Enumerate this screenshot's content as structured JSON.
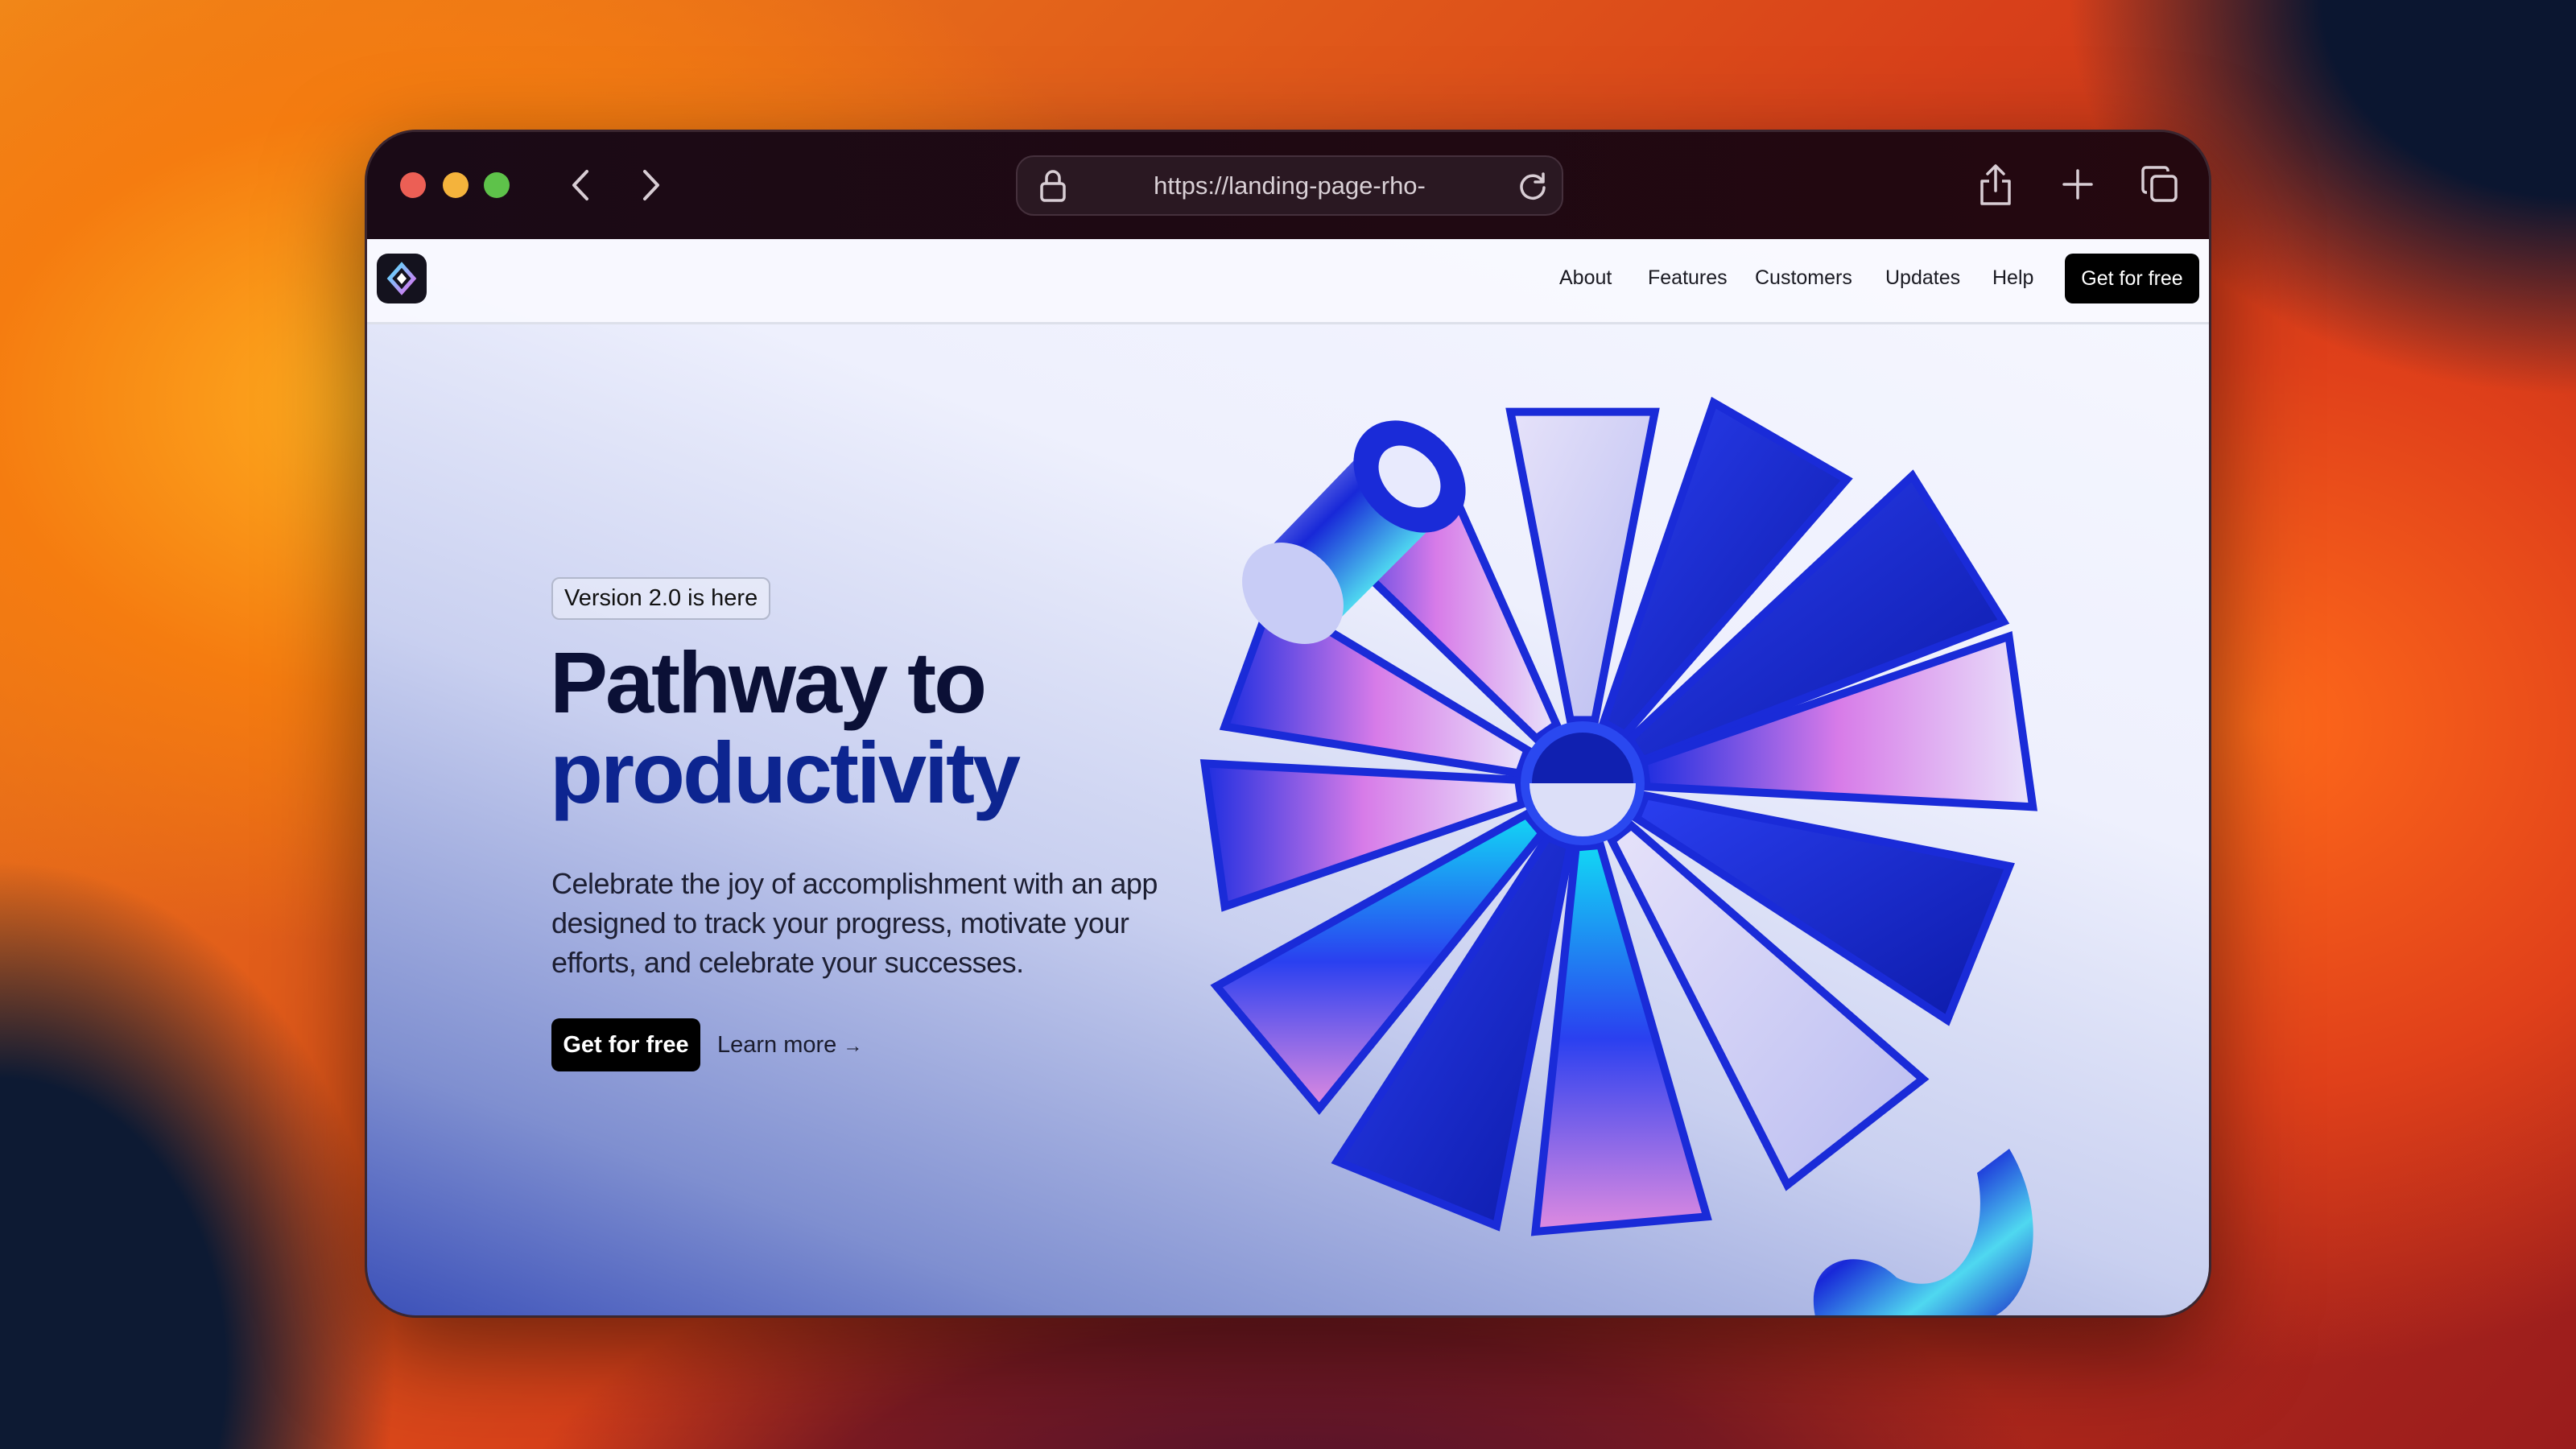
{
  "browser": {
    "url": "https://landing-page-rho-",
    "traffic_lights": {
      "close": "#ec5f55",
      "minimize": "#f4b33c",
      "zoom": "#5ec24a"
    },
    "icons": [
      "chevron-left-icon",
      "chevron-right-icon",
      "lock-icon",
      "reload-icon",
      "share-icon",
      "plus-icon",
      "tabs-icon"
    ]
  },
  "nav": {
    "items": [
      {
        "label": "About"
      },
      {
        "label": "Features"
      },
      {
        "label": "Customers"
      },
      {
        "label": "Updates"
      },
      {
        "label": "Help"
      }
    ],
    "cta": "Get for free"
  },
  "hero": {
    "badge": "Version 2.0 is here",
    "title_line1": "Pathway to",
    "title_line2": "productivity",
    "description": "Celebrate the joy of accomplishment with an app designed to track your progress, motivate your efforts, and celebrate your successes.",
    "primary_cta": "Get for free",
    "secondary_cta": "Learn more",
    "secondary_icon": "arrow-right-icon"
  },
  "colors": {
    "accent": "#1a2bd8",
    "heading": "#0b1036",
    "heading_accent": "#0d2590"
  }
}
